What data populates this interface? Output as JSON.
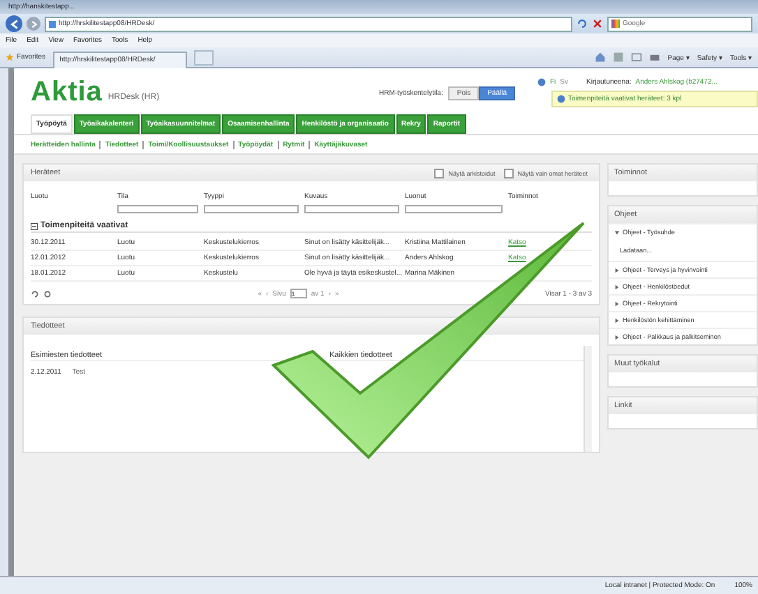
{
  "browser": {
    "tab_title": "http://hanskitestapp...",
    "address": "http://hrskilitestapp08/HRDesk/",
    "search_placeholder": "Google",
    "menu": [
      "File",
      "Edit",
      "View",
      "Favorites",
      "Tools",
      "Help"
    ],
    "favorites_label": "Favorites",
    "page_tab": "http://hrskilitestapp08/HRDesk/",
    "commands": [
      "Page ▾",
      "Safety ▾",
      "Tools ▾"
    ]
  },
  "header": {
    "logo": "Aktia",
    "app_name": "HRDesk (HR)",
    "mode_label": "HRM-työskentelytila:",
    "modes": [
      {
        "label": "Pois",
        "selected": false
      },
      {
        "label": "Päällä",
        "selected": true
      }
    ],
    "languages": [
      {
        "label": "Fi",
        "selected": true
      },
      {
        "label": "Sv",
        "selected": false
      }
    ],
    "login_label": "Kirjautuneena:",
    "user": "Anders Ahlskog (b27472...",
    "notice": "Toimenpiteitä vaativat heräteet: 3 kpl"
  },
  "tabs": [
    {
      "label": "Työpöytä",
      "selected": true
    },
    {
      "label": "Työaikakalenteri",
      "selected": false
    },
    {
      "label": "Työaikasuunnitelmat",
      "selected": false
    },
    {
      "label": "Osaamisenhallinta",
      "selected": false
    },
    {
      "label": "Henkilöstö ja organisaatio",
      "selected": false
    },
    {
      "label": "Rekry",
      "selected": false
    },
    {
      "label": "Raportit",
      "selected": false
    }
  ],
  "subnav": [
    "Herätteiden hallinta",
    "Tiedotteet",
    "Toimi/Koollisuustaukset",
    "Työpöydät",
    "Rytmit",
    "Käyttäjäkuvaset"
  ],
  "alerts": {
    "title": "Heräteet",
    "options": [
      {
        "label": "Näytä arkistoidut",
        "checked": false
      },
      {
        "label": "Näytä vain omat heräteet",
        "checked": false
      }
    ],
    "columns": [
      {
        "label": "Luotu",
        "filter": false
      },
      {
        "label": "Tila",
        "filter": true
      },
      {
        "label": "Tyyppi",
        "filter": true
      },
      {
        "label": "Kuvaus",
        "filter": true
      },
      {
        "label": "Luonut",
        "filter": true
      },
      {
        "label": "Toiminnot",
        "filter": false
      }
    ],
    "group": "Toimenpiteitä vaativat",
    "rows": [
      {
        "cells": [
          "30.12.2011",
          "Luotu",
          "Keskustelukierros",
          "Sinut on lisätty käsittelijäk...",
          "Kristiina Mattilainen"
        ],
        "action": "Katso"
      },
      {
        "cells": [
          "12.01.2012",
          "Luotu",
          "Keskustelukierros",
          "Sinut on lisätty käsittelijäk...",
          "Anders Ahlskog"
        ],
        "action": "Katso"
      },
      {
        "cells": [
          "18.01.2012",
          "Luotu",
          "Keskustelu",
          "Ole hyvä ja täytä esikeskustel...",
          "Marina Mäkinen"
        ]
      }
    ],
    "pager": {
      "first": "«",
      "prev": "‹",
      "page_label": "Sivu",
      "page": "1",
      "of": "av 1",
      "next": "›",
      "last": "»"
    },
    "summary": "Visar 1 - 3 av 3"
  },
  "notices": {
    "title": "Tiedotteet",
    "columns": [
      "Esimiesten tiedotteet",
      "Kaikkien tiedotteet"
    ],
    "rows": [
      {
        "date": "2.12.2011",
        "text": "Test"
      }
    ]
  },
  "sidebar": {
    "actions_title": "Toiminnot",
    "help_title": "Ohjeet",
    "help_items": [
      {
        "label": "Ohjeet - Työsuhde",
        "expanded": true,
        "children": [
          {
            "label": "Ladataan..."
          }
        ]
      },
      {
        "label": "Ohjeet - Terveys ja hyvinvointi",
        "expanded": false
      },
      {
        "label": "Ohjeet - Henkilöstöedut",
        "expanded": false
      },
      {
        "label": "Ohjeet - Rekrytointi",
        "expanded": false
      },
      {
        "label": "Henkilöstön kehittäminen",
        "expanded": false
      },
      {
        "label": "Ohjeet - Palkkaus ja palkitseminen",
        "expanded": false
      }
    ],
    "tools_title": "Muut työkalut",
    "links_title": "Linkit"
  },
  "status": {
    "zone": "Local intranet | Protected Mode: On",
    "zoom": "100%"
  }
}
